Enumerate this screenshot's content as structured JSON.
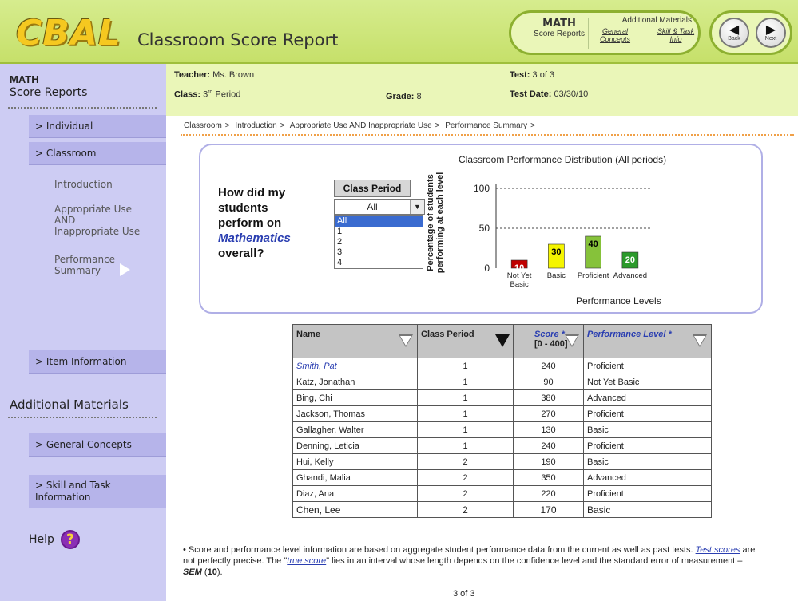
{
  "header": {
    "logo": "CBAL",
    "title": "Classroom Score Report",
    "nav_math_title": "MATH",
    "nav_math_sub": "Score Reports",
    "nav_additional_title": "Additional Materials",
    "nav_link_general": "General Concepts",
    "nav_link_skill": "Skill & Task Info",
    "back_label": "Back",
    "next_label": "Next"
  },
  "sidebar": {
    "heading1": "MATH",
    "heading2": "Score Reports",
    "individual": "> Individual",
    "classroom": "> Classroom",
    "sub_intro": "Introduction",
    "sub_appropriate": "Appropriate Use AND Inappropriate Use",
    "sub_performance": "Performance Summary",
    "item_information": "> Item Information",
    "additional_heading": "Additional Materials",
    "general_concepts": "> General Concepts",
    "skill_task": "> Skill and Task Information",
    "help": "Help"
  },
  "info": {
    "teacher_label": "Teacher:",
    "teacher_value": "Ms. Brown",
    "class_label": "Class:",
    "class_value_num": "3",
    "class_value_sup": "rd",
    "class_value_rest": "Period",
    "grade_label": "Grade:",
    "grade_value": "8",
    "test_label": "Test:",
    "test_value": "3 of 3",
    "date_label": "Test Date:",
    "date_value": "03/30/10"
  },
  "breadcrumb": [
    "Classroom",
    "Introduction",
    "Appropriate Use AND Inappropriate Use",
    "Performance Summary"
  ],
  "breadcrumb_separator": ">",
  "question": {
    "line1": "How did my",
    "line2": "students",
    "line3": "perform on",
    "link": "Mathematics",
    "line5": "overall?"
  },
  "class_period": {
    "header": "Class Period",
    "selected": "All",
    "options": [
      "All",
      "1",
      "2",
      "3",
      "4"
    ]
  },
  "chart_data": {
    "type": "bar",
    "title": "Classroom Performance Distribution (All periods)",
    "xlabel": "Performance Levels",
    "ylabel": "Percentage of students performing at each level",
    "categories": [
      "Not Yet Basic",
      "Basic",
      "Proficient",
      "Advanced"
    ],
    "values": [
      10,
      30,
      40,
      20
    ],
    "colors": [
      "#c00000",
      "#f5f500",
      "#86c23a",
      "#2b9a2b"
    ],
    "label_colors": [
      "#ffffff",
      "#000000",
      "#000000",
      "#ffffff"
    ],
    "yticks": [
      0,
      50,
      100
    ],
    "ylim": [
      0,
      100
    ],
    "grid": "dashed at 50 and 100"
  },
  "table": {
    "headers": {
      "name": "Name",
      "period": "Class Period",
      "score": "Score *",
      "score_range": "[0 - 400]",
      "level": "Performance Level *"
    },
    "rows": [
      {
        "name": "Smith, Pat",
        "period": "1",
        "score": "240",
        "level": "Proficient"
      },
      {
        "name": "Katz, Jonathan",
        "period": "1",
        "score": "90",
        "level": "Not Yet Basic"
      },
      {
        "name": "Bing, Chi",
        "period": "1",
        "score": "380",
        "level": "Advanced"
      },
      {
        "name": "Jackson, Thomas",
        "period": "1",
        "score": "270",
        "level": "Proficient"
      },
      {
        "name": "Gallagher, Walter",
        "period": "1",
        "score": "130",
        "level": "Basic"
      },
      {
        "name": "Denning, Leticia",
        "period": "1",
        "score": "240",
        "level": "Proficient"
      },
      {
        "name": "Hui, Kelly",
        "period": "2",
        "score": "190",
        "level": "Basic"
      },
      {
        "name": "Ghandi, Malia",
        "period": "2",
        "score": "350",
        "level": "Advanced"
      },
      {
        "name": "Diaz, Ana",
        "period": "2",
        "score": "220",
        "level": "Proficient"
      },
      {
        "name": "Chen, Lee",
        "period": "2",
        "score": "170",
        "level": "Basic"
      }
    ]
  },
  "footnote": {
    "part1": "• Score and performance level information are based on aggregate student performance data from the current as well as past tests. ",
    "link1": "Test scores",
    "part2": " are not perfectly precise. The \"",
    "link2": "true score",
    "part3": "\" lies in an interval whose length depends on the confidence level and the standard error of measurement –",
    "sem": "SEM",
    "part4": " (",
    "sem_value": "10",
    "part5": ")."
  },
  "page_number": "3 of 3"
}
